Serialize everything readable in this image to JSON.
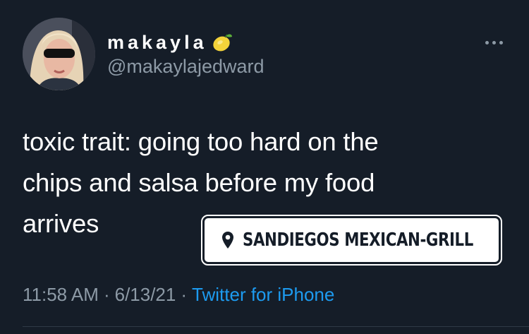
{
  "tweet": {
    "display_name": "makayla",
    "display_name_emoji": "lemon-icon",
    "handle": "@makaylajedward",
    "text": "toxic trait: going too hard on the\nchips and salsa before my food\narrives",
    "time": "11:58 AM",
    "date": "6/13/21",
    "separator": "·",
    "source": "Twitter for iPhone"
  },
  "location_sticker": {
    "icon": "location-pin-icon",
    "label": "SANDIEGOS MEXICAN-GRILL"
  },
  "colors": {
    "background": "#151d28",
    "text": "#ffffff",
    "secondary": "#8d9aa6",
    "link": "#1d9bf0",
    "sticker_bg": "#ffffff"
  }
}
